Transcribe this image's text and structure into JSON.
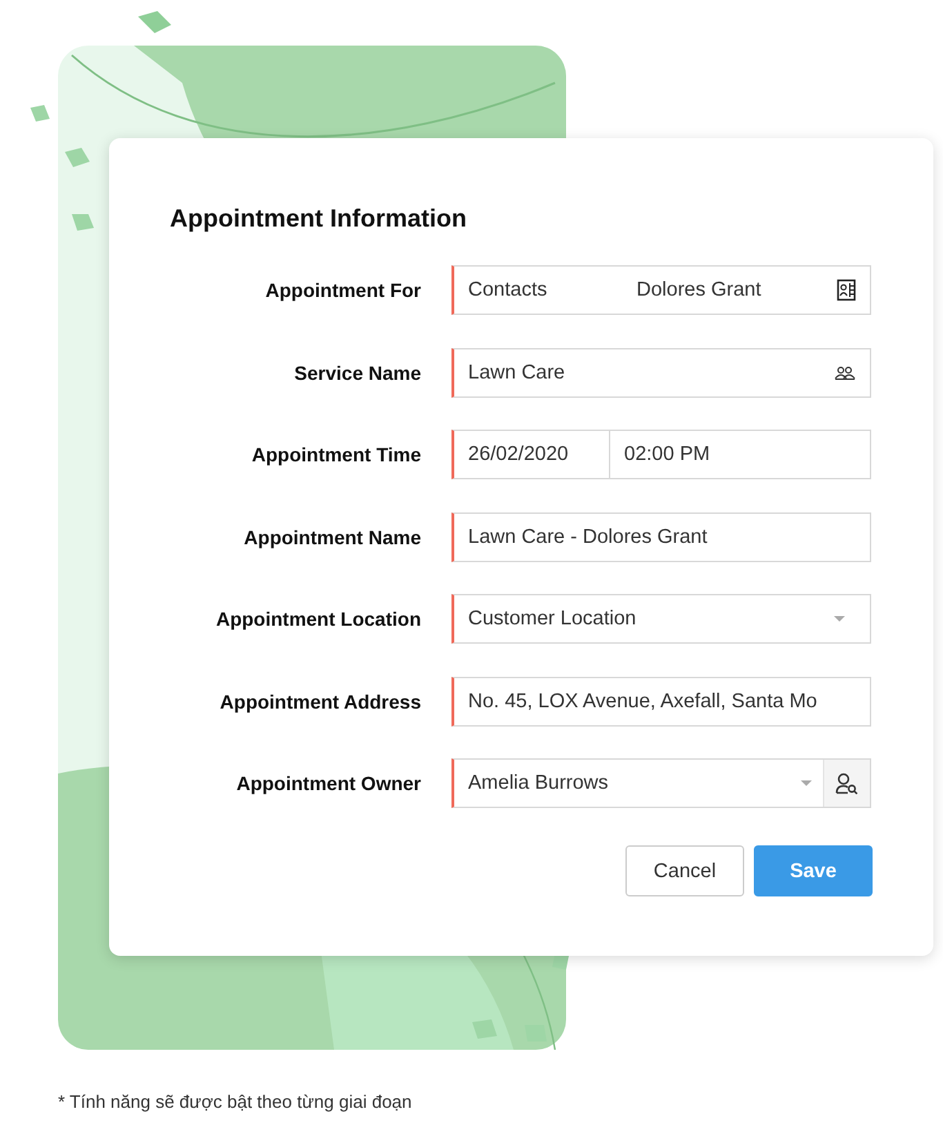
{
  "form": {
    "title": "Appointment Information",
    "fields": [
      {
        "label": "Appointment For",
        "kind": "lookup",
        "required": true,
        "values": [
          "Contacts",
          "Dolores Grant"
        ]
      },
      {
        "label": "Service Name",
        "kind": "search",
        "required": true,
        "values": [
          "Lawn Care"
        ]
      },
      {
        "label": "Appointment Time",
        "kind": "datetime",
        "required": true,
        "values": [
          "26/02/2020",
          "02:00 PM"
        ]
      },
      {
        "label": "Appointment Name",
        "kind": "text",
        "required": true,
        "values": [
          "Lawn Care - Dolores Grant"
        ]
      },
      {
        "label": "Appointment Location",
        "kind": "select",
        "required": true,
        "values": [
          "Customer Location"
        ]
      },
      {
        "label": "Appointment Address",
        "kind": "text",
        "required": true,
        "values": [
          "No. 45, LOX Avenue, Axefall, Santa Mo"
        ]
      },
      {
        "label": "Appointment Owner",
        "kind": "select_user",
        "required": true,
        "values": [
          "Amelia Burrows"
        ]
      }
    ],
    "buttons": [
      {
        "label": "Cancel",
        "kind": "secondary"
      },
      {
        "label": "Save",
        "kind": "primary"
      }
    ]
  },
  "footnote": "* Tính năng sẽ được bật theo từng giai đoạn"
}
